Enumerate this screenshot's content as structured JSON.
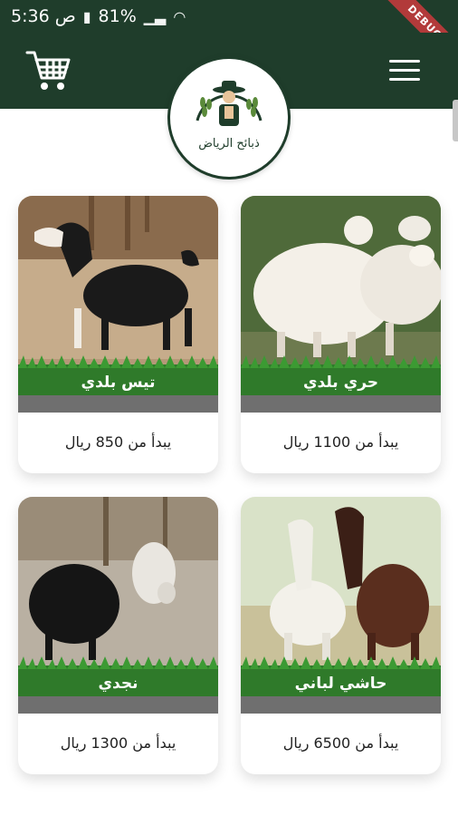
{
  "status_bar": {
    "time": "5:36 ص",
    "battery": "81%",
    "debug_label": "DEBUG"
  },
  "header": {
    "logo_text": "ذبائح الرياض"
  },
  "products": [
    {
      "name": "تيس بلدي",
      "price_label": "يبدأ من  850 ريال",
      "image": "black-white-goat"
    },
    {
      "name": "حري بلدي",
      "price_label": "يبدأ من  1100 ريال",
      "image": "white-sheep"
    },
    {
      "name": "نجدي",
      "price_label": "يبدأ من  1300 ريال",
      "image": "najdi-sheep"
    },
    {
      "name": "حاشي لباني",
      "price_label": "يبدأ من  6500 ريال",
      "image": "camels"
    }
  ],
  "colors": {
    "header_green": "#1f3d2b",
    "grass_green": "#2f7a2a",
    "name_bar_gray": "#6f6f6f"
  }
}
